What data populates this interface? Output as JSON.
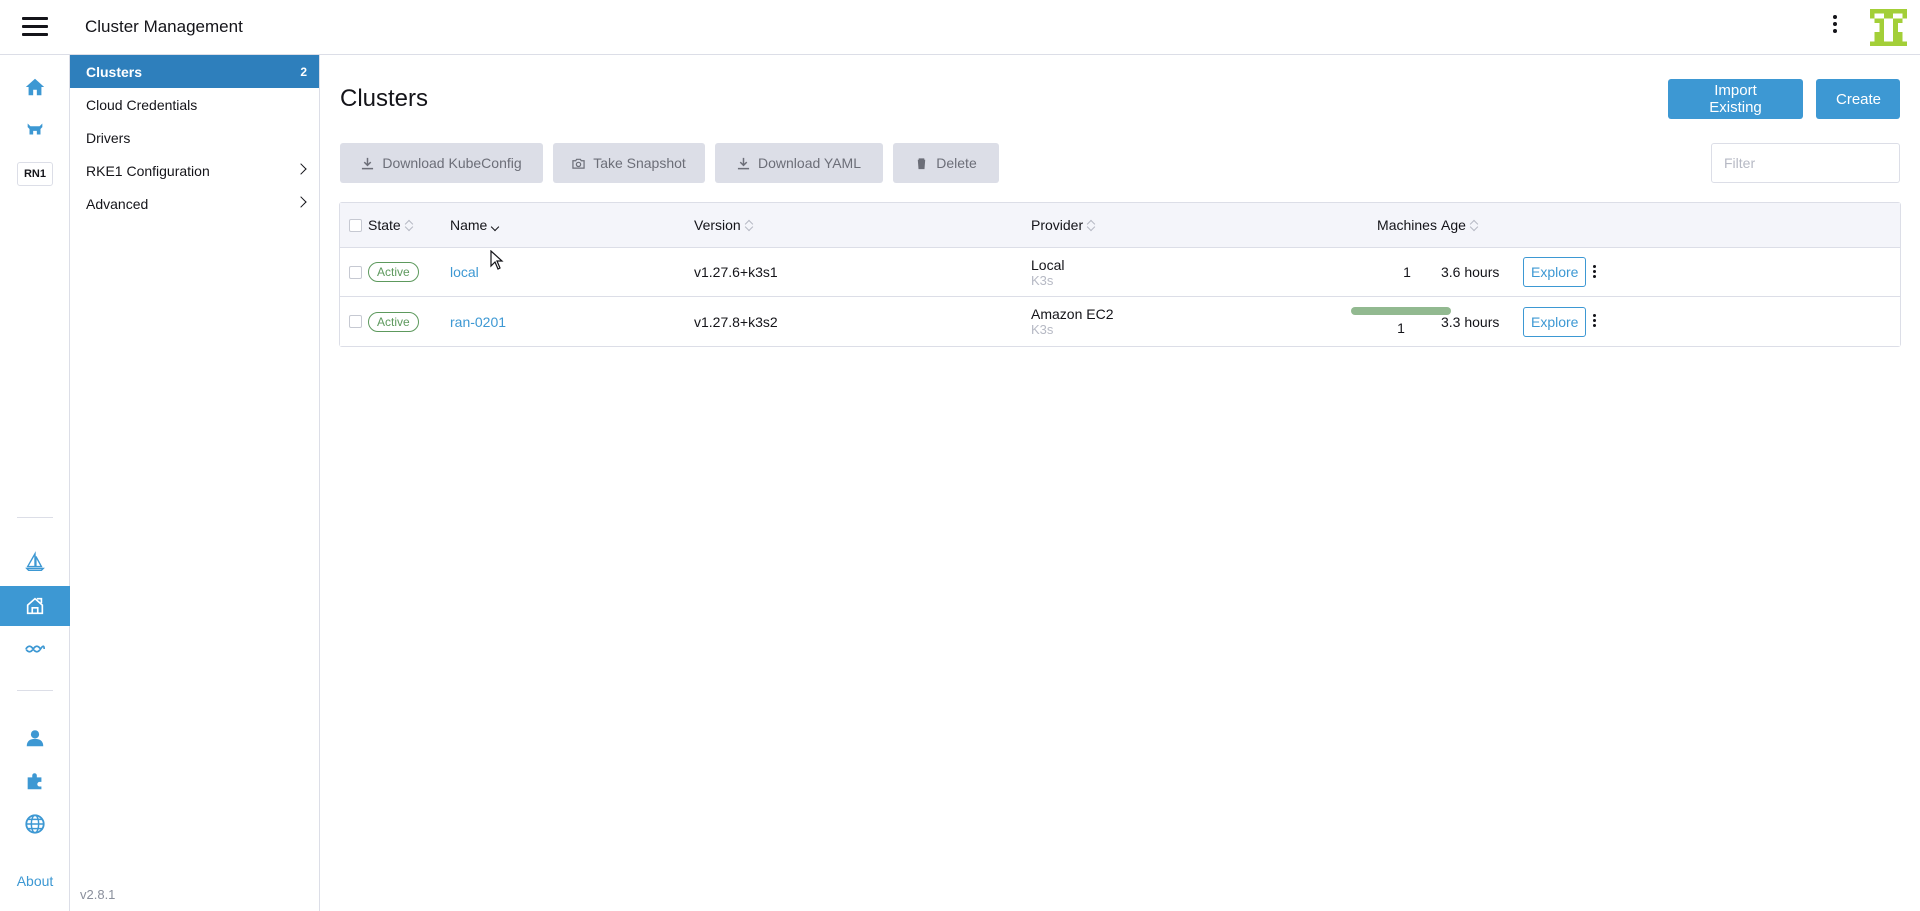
{
  "app": {
    "title": "Cluster Management",
    "version": "v2.8.1",
    "about": "About",
    "rail_badge": "RN1",
    "logo_color": "#a3cf38"
  },
  "sidebar": {
    "items": [
      {
        "label": "Clusters",
        "count": "2",
        "active": true
      },
      {
        "label": "Cloud Credentials"
      },
      {
        "label": "Drivers"
      },
      {
        "label": "RKE1 Configuration",
        "expandable": true
      },
      {
        "label": "Advanced",
        "expandable": true
      }
    ]
  },
  "page": {
    "title": "Clusters",
    "import_label": "Import Existing",
    "create_label": "Create",
    "filter_placeholder": "Filter"
  },
  "bulk_actions": {
    "download_kubeconfig": "Download KubeConfig",
    "take_snapshot": "Take Snapshot",
    "download_yaml": "Download YAML",
    "delete": "Delete"
  },
  "table": {
    "columns": {
      "state": "State",
      "name": "Name",
      "version": "Version",
      "provider": "Provider",
      "machines": "Machines",
      "age": "Age"
    },
    "rows": [
      {
        "state": "Active",
        "name": "local",
        "version": "v1.27.6+k3s1",
        "provider": "Local",
        "provider_sub": "K3s",
        "machines": "1",
        "machines_bar": false,
        "age": "3.6 hours",
        "action": "Explore"
      },
      {
        "state": "Active",
        "name": "ran-0201",
        "version": "v1.27.8+k3s2",
        "provider": "Amazon EC2",
        "provider_sub": "K3s",
        "machines": "1",
        "machines_bar": true,
        "machines_ready_fraction": 1.0,
        "age": "3.3 hours",
        "action": "Explore"
      }
    ]
  },
  "colors": {
    "accent": "#3d98d3",
    "nav_active": "#2e7fbc",
    "active_badge": "#5d995d",
    "machines_bar": "#92b990"
  }
}
